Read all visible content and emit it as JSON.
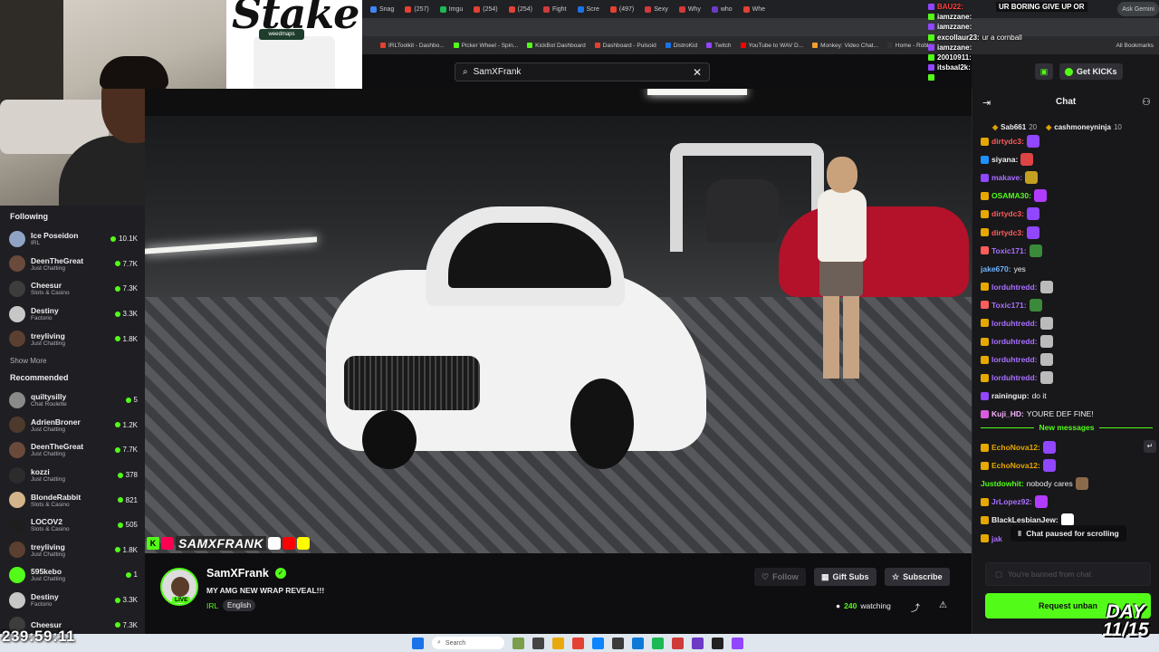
{
  "browser": {
    "tabs": [
      "Snag",
      "(257)",
      "Imgu",
      "(254)",
      "(254)",
      "Fight",
      "Scre",
      "(497)",
      "Sexy",
      "Why",
      "who",
      "Whe"
    ],
    "bookmarks": [
      "IRLToolkit - Dashbo...",
      "Picker Wheel - Spin...",
      "KickBot Dashboard",
      "Dashboard - Pulsoid",
      "DistroKid",
      "Twitch",
      "YouTube to WAV D...",
      "Monkey: Video Chat...",
      "Home - Roblox"
    ],
    "all_bookmarks": "All Bookmarks",
    "ask_gemini": "Ask Gemini"
  },
  "sponsor": {
    "brand": "Stake",
    "sub": "weedmaps"
  },
  "search": {
    "value": "SamXFrank"
  },
  "sidebar": {
    "following_header": "Following",
    "following": [
      {
        "name": "Ice Poseidon",
        "category": "IRL",
        "viewers": "10.1K",
        "color": "#8fa3c4"
      },
      {
        "name": "DeenTheGreat",
        "category": "Just Chatting",
        "viewers": "7.7K",
        "color": "#6a4a3a"
      },
      {
        "name": "Cheesur",
        "category": "Slots & Casino",
        "viewers": "7.3K",
        "color": "#3d3d3d"
      },
      {
        "name": "Destiny",
        "category": "Factorio",
        "viewers": "3.3K",
        "color": "#c7c7c7"
      },
      {
        "name": "treyliving",
        "category": "Just Chatting",
        "viewers": "1.8K",
        "color": "#5b3f30"
      }
    ],
    "show_more": "Show More",
    "recommended_header": "Recommended",
    "recommended": [
      {
        "name": "quiltysilly",
        "category": "Chat Roulette",
        "viewers": "5",
        "color": "#8a8a8a"
      },
      {
        "name": "AdrienBroner",
        "category": "Just Chatting",
        "viewers": "1.2K",
        "color": "#4e3a2c"
      },
      {
        "name": "DeenTheGreat",
        "category": "Just Chatting",
        "viewers": "7.7K",
        "color": "#6a4a3a"
      },
      {
        "name": "kozzi",
        "category": "Just Chatting",
        "viewers": "378",
        "color": "#2c2c2c"
      },
      {
        "name": "BlondeRabbit",
        "category": "Slots & Casino",
        "viewers": "821",
        "color": "#d4b48a"
      },
      {
        "name": "LOCOV2",
        "category": "Slots & Casino",
        "viewers": "505",
        "color": "#1e1e1e"
      },
      {
        "name": "treyliving",
        "category": "Just Chatting",
        "viewers": "1.8K",
        "color": "#5b3f30"
      },
      {
        "name": "595kebo",
        "category": "Just Chatting",
        "viewers": "1",
        "color": "#53fc18"
      },
      {
        "name": "Destiny",
        "category": "Factorio",
        "viewers": "3.3K",
        "color": "#c7c7c7"
      },
      {
        "name": "Cheesur",
        "category": "",
        "viewers": "7.3K",
        "color": "#3d3d3d"
      }
    ]
  },
  "video": {
    "overlay_handle": "SAMXFRANK",
    "overlay_k": "K"
  },
  "channel": {
    "name": "SamXFrank",
    "title": "MY AMG NEW WRAP REVEAL!!!",
    "category": "IRL",
    "language": "English",
    "live": "LIVE",
    "follow": "Follow",
    "gift_subs": "Gift Subs",
    "subscribe": "Subscribe",
    "watching_count": "240",
    "watching_label": "watching"
  },
  "chat": {
    "get_kicks": "Get KICKs",
    "title": "Chat",
    "gifters": [
      {
        "name": "Sab661",
        "count": "20"
      },
      {
        "name": "cashmoneyninja",
        "count": "10"
      }
    ],
    "messages": [
      {
        "user": "dirtydc3:",
        "text": "",
        "color": "#ff5c5c",
        "badge": "#e6a800",
        "emote": "#9146ff"
      },
      {
        "user": "siyana:",
        "text": "",
        "color": "#efeff1",
        "badge": "#1e90ff",
        "emote": "#d44"
      },
      {
        "user": "makave:",
        "text": "",
        "color": "#a970ff",
        "badge": "#9146ff",
        "emote": "#c4a020"
      },
      {
        "user": "OSAMA30:",
        "text": "",
        "color": "#53fc18",
        "badge": "#e6a800",
        "emote": "#b13cff"
      },
      {
        "user": "dirtydc3:",
        "text": "",
        "color": "#ff5c5c",
        "badge": "#e6a800",
        "emote": "#9146ff"
      },
      {
        "user": "dirtydc3:",
        "text": "",
        "color": "#ff5c5c",
        "badge": "#e6a800",
        "emote": "#9146ff"
      },
      {
        "user": "Toxic171:",
        "text": "",
        "color": "#a970ff",
        "badge": "#ff5c5c",
        "emote": "#3a8a3a"
      },
      {
        "user": "jake670:",
        "text": "yes",
        "color": "#6fb5ff",
        "badge": "",
        "emote": ""
      },
      {
        "user": "lorduhtredd:",
        "text": "",
        "color": "#a970ff",
        "badge": "#e6a800",
        "emote": "#bbbbbb"
      },
      {
        "user": "Toxic171:",
        "text": "",
        "color": "#a970ff",
        "badge": "#ff5c5c",
        "emote": "#3a8a3a"
      },
      {
        "user": "lorduhtredd:",
        "text": "",
        "color": "#a970ff",
        "badge": "#e6a800",
        "emote": "#bbbbbb"
      },
      {
        "user": "lorduhtredd:",
        "text": "",
        "color": "#a970ff",
        "badge": "#e6a800",
        "emote": "#bbbbbb"
      },
      {
        "user": "lorduhtredd:",
        "text": "",
        "color": "#a970ff",
        "badge": "#e6a800",
        "emote": "#bbbbbb"
      },
      {
        "user": "lorduhtredd:",
        "text": "",
        "color": "#a970ff",
        "badge": "#e6a800",
        "emote": "#bbbbbb"
      },
      {
        "user": "rainingup:",
        "text": "do it",
        "color": "#efeff1",
        "badge": "#9146ff",
        "emote": ""
      },
      {
        "user": "Kuji_HD:",
        "text": "YOURE DEF FINE!",
        "color": "#f7b3ff",
        "badge": "#d95ce0",
        "emote": ""
      }
    ],
    "new_messages": "New messages",
    "messages_after": [
      {
        "user": "EchoNova12:",
        "text": "",
        "color": "#e6a800",
        "badge": "#e6a800",
        "emote": "#9146ff"
      },
      {
        "user": "EchoNova12:",
        "text": "",
        "color": "#e6a800",
        "badge": "#e6a800",
        "emote": "#9146ff"
      },
      {
        "user": "Justdowhit:",
        "text": "nobody cares",
        "color": "#53fc18",
        "badge": "",
        "emote": "#8a6a4a"
      },
      {
        "user": "JrLopez92:",
        "text": "",
        "color": "#a970ff",
        "badge": "#e6a800",
        "emote": "#b13cff"
      },
      {
        "user": "BlackLesbianJew:",
        "text": "",
        "color": "#efeff1",
        "badge": "#e6a800",
        "emote": "#ffffff"
      },
      {
        "user": "jak",
        "text": "",
        "color": "#a970ff",
        "badge": "#e6a800",
        "emote": ""
      }
    ],
    "paused": "Chat paused for scrolling",
    "banned_placeholder": "You're banned from chat",
    "unban_button": "Request unban"
  },
  "overlay_chat": {
    "banner": "UR BORING GIVE UP OR",
    "lines": [
      {
        "user": "BAU22:",
        "text": "",
        "red": true
      },
      {
        "user": "iamzzane:",
        "text": ""
      },
      {
        "user": "iamzzane:",
        "text": ""
      },
      {
        "user": "excollaur23:",
        "text": "ur a cornball"
      },
      {
        "user": "iamzzane:",
        "text": ""
      },
      {
        "user": "20010911:",
        "text": ""
      },
      {
        "user": "itsbaal2k:",
        "text": ""
      },
      {
        "user": "",
        "text": ""
      }
    ]
  },
  "stream_overlay": {
    "timer": "239:59:11",
    "day_line1": "DAY",
    "day_line2": "11/15"
  },
  "taskbar": {
    "search": "Search"
  }
}
